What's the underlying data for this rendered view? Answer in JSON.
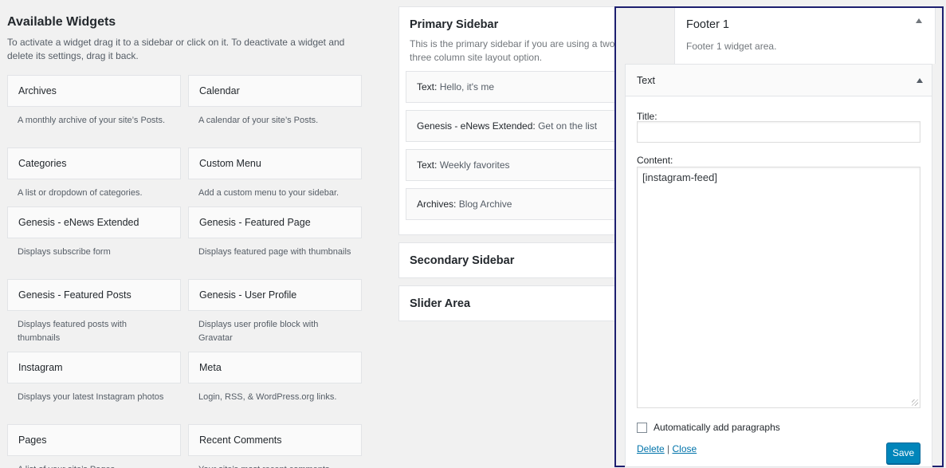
{
  "available": {
    "title": "Available Widgets",
    "description": "To activate a widget drag it to a sidebar or click on it. To deactivate a widget and delete its settings, drag it back.",
    "widgets": [
      {
        "name": "Archives",
        "desc": "A monthly archive of your site’s Posts."
      },
      {
        "name": "Calendar",
        "desc": "A calendar of your site’s Posts."
      },
      {
        "name": "Categories",
        "desc": "A list or dropdown of categories."
      },
      {
        "name": "Custom Menu",
        "desc": "Add a custom menu to your sidebar."
      },
      {
        "name": "Genesis - eNews Extended",
        "desc": "Displays subscribe form"
      },
      {
        "name": "Genesis - Featured Page",
        "desc": "Displays featured page with thumbnails"
      },
      {
        "name": "Genesis - Featured Posts",
        "desc": "Displays featured posts with thumbnails"
      },
      {
        "name": "Genesis - User Profile",
        "desc": "Displays user profile block with Gravatar"
      },
      {
        "name": "Instagram",
        "desc": "Displays your latest Instagram photos"
      },
      {
        "name": "Meta",
        "desc": "Login, RSS, & WordPress.org links."
      },
      {
        "name": "Pages",
        "desc": "A list of your site’s Pages."
      },
      {
        "name": "Recent Comments",
        "desc": "Your site’s most recent comments."
      }
    ]
  },
  "primary_sidebar": {
    "title": "Primary Sidebar",
    "description": "This is the primary sidebar if you are using a two or three column site layout option.",
    "widgets": [
      {
        "type": "Text:",
        "instance": "Hello, it's me"
      },
      {
        "type": "Genesis - eNews Extended:",
        "instance": "Get on the list"
      },
      {
        "type": "Text:",
        "instance": "Weekly favorites"
      },
      {
        "type": "Archives:",
        "instance": "Blog Archive"
      }
    ]
  },
  "secondary_sidebar": {
    "title": "Secondary Sidebar"
  },
  "slider_area": {
    "title": "Slider Area"
  },
  "footer1": {
    "title": "Footer 1",
    "description": "Footer 1 widget area.",
    "text_widget": {
      "header": "Text",
      "title_label": "Title:",
      "title_value": "",
      "content_label": "Content:",
      "content_value": "[instagram-feed]",
      "autop_label": "Automatically add paragraphs",
      "delete_label": "Delete",
      "separator": "|",
      "close_label": "Close",
      "save_label": "Save"
    }
  }
}
